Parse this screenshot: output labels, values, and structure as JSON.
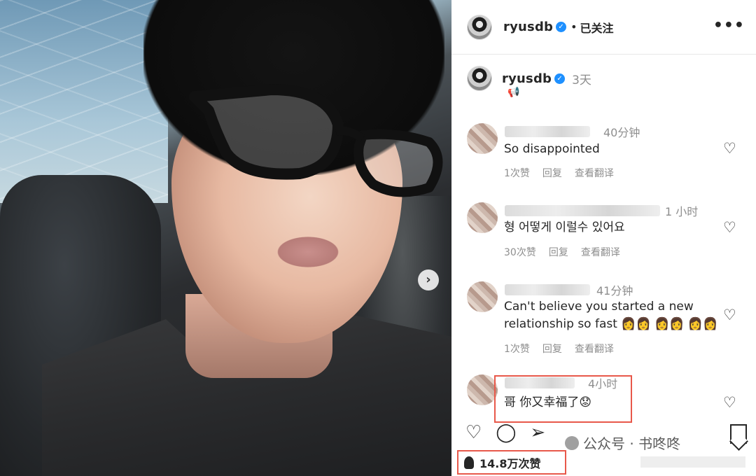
{
  "post": {
    "username": "ryusdb",
    "follow_status": "已关注",
    "caption_time": "3天",
    "more_icon": "more-horizontal-icon"
  },
  "comments": [
    {
      "time": "40分钟",
      "text": "So disappointed",
      "likes": "1次赞",
      "reply": "回复",
      "translate": "查看翻译"
    },
    {
      "time": "1 小时",
      "text": "형 어떻게 이럴수 있어요",
      "likes": "30次赞",
      "reply": "回复",
      "translate": "查看翻译"
    },
    {
      "time": "41分钟",
      "text_line1": "Can't believe you started a new",
      "text_line2": "relationship so fast",
      "likes": "1次赞",
      "reply": "回复",
      "translate": "查看翻译"
    },
    {
      "time": "4小时",
      "text": "哥 你又幸福了"
    }
  ],
  "footer": {
    "likes_count": "14.8万次赞",
    "watermark": "公众号 · 书咚咚"
  },
  "colors": {
    "verified": "#1e90ff",
    "highlight_box": "#e8584a",
    "muted_text": "#8e8e8e"
  }
}
